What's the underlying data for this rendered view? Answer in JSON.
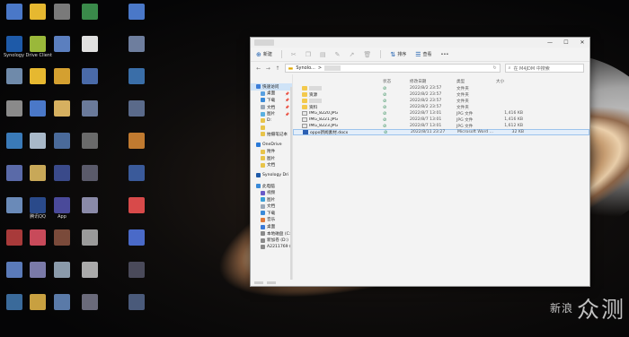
{
  "desktop": {
    "icons": [
      {
        "label": "",
        "color": "#4a78c8"
      },
      {
        "label": "",
        "color": "#e6b830"
      },
      {
        "label": "",
        "color": "#7a7a7a"
      },
      {
        "label": "",
        "color": "#3a8a4a"
      },
      {
        "label": "",
        "color": "#4a78c8"
      },
      {
        "label": "Synology Drive Client",
        "color": "#1e5aa8"
      },
      {
        "label": "",
        "color": "#9ab83a"
      },
      {
        "label": "",
        "color": "#5b7fbf"
      },
      {
        "label": "",
        "color": "#e0e0e0"
      },
      {
        "label": "",
        "color": "#6e7e9e"
      },
      {
        "label": "",
        "color": "#6f8aaa"
      },
      {
        "label": "",
        "color": "#e6b830"
      },
      {
        "label": "",
        "color": "#d4a030"
      },
      {
        "label": "",
        "color": "#4a6aa8"
      },
      {
        "label": "",
        "color": "#3a6ea8"
      },
      {
        "label": "",
        "color": "#8a8a8a"
      },
      {
        "label": "",
        "color": "#4a78c8"
      },
      {
        "label": "",
        "color": "#d6b060"
      },
      {
        "label": "",
        "color": "#6a7a9a"
      },
      {
        "label": "",
        "color": "#5a6a8a"
      },
      {
        "label": "",
        "color": "#3a7ab8"
      },
      {
        "label": "",
        "color": "#a8b8c8"
      },
      {
        "label": "",
        "color": "#4a6a9a"
      },
      {
        "label": "",
        "color": "#6a6a6a"
      },
      {
        "label": "",
        "color": "#c07a30"
      },
      {
        "label": "",
        "color": "#5a6aa8"
      },
      {
        "label": "",
        "color": "#c8a858"
      },
      {
        "label": "",
        "color": "#3a4a8a"
      },
      {
        "label": "",
        "color": "#5a5a6a"
      },
      {
        "label": "",
        "color": "#3a5a9a"
      },
      {
        "label": "",
        "color": "#6a8ab8"
      },
      {
        "label": "腾讯QQ",
        "color": "#2a4a8a"
      },
      {
        "label": "App",
        "color": "#4a4a9a"
      },
      {
        "label": "",
        "color": "#8a8aa8"
      },
      {
        "label": "",
        "color": "#d84a4a"
      },
      {
        "label": "",
        "color": "#a83a3a"
      },
      {
        "label": "",
        "color": "#c84a5a"
      },
      {
        "label": "",
        "color": "#7a4a3a"
      },
      {
        "label": "",
        "color": "#9a9a9a"
      },
      {
        "label": "",
        "color": "#4a6ac8"
      },
      {
        "label": "",
        "color": "#5a7ab8"
      },
      {
        "label": "",
        "color": "#7a7aa8"
      },
      {
        "label": "",
        "color": "#8a9aaa"
      },
      {
        "label": "",
        "color": "#aaaaaa"
      },
      {
        "label": "",
        "color": "#4a4a5a"
      },
      {
        "label": "",
        "color": "#3a6a9a"
      },
      {
        "label": "",
        "color": "#c8a040"
      },
      {
        "label": "",
        "color": "#5a7aa8"
      },
      {
        "label": "",
        "color": "#6a6a7a"
      },
      {
        "label": "",
        "color": "#4a5a7a"
      }
    ]
  },
  "window": {
    "toolbar": {
      "new_label": "新建",
      "sort_label": "排序",
      "view_label": "查看",
      "more_label": "•••"
    },
    "address": {
      "path_root": "Synolo...",
      "path_sep": ">",
      "search_placeholder": "在 M4JDM 中搜索"
    },
    "sidebar": {
      "quick_access": "快速访问",
      "items_pinned": [
        "桌面",
        "下载",
        "文档",
        "图片"
      ],
      "items_unpinned": [
        "D:",
        "",
        "拍摄笔记本"
      ],
      "onedrive": "OneDrive",
      "onedrive_items": [
        "附件",
        "图片",
        "文档"
      ],
      "synology": "Synology Dri",
      "this_pc": "此电脑",
      "pc_items": [
        "视频",
        "图片",
        "文档",
        "下载",
        "音乐",
        "桌面",
        "本地磁盘 (C:",
        "新加卷 (D:)",
        "A2211769 ("
      ]
    },
    "columns": {
      "status": "状态",
      "date": "修改日期",
      "type": "类型",
      "size": "大小"
    },
    "files": [
      {
        "name": "",
        "kind": "folder",
        "date": "2022/8/2 23:57",
        "type": "文件夹",
        "size": ""
      },
      {
        "name": "资源",
        "kind": "folder",
        "date": "2022/8/2 23:57",
        "type": "文件夹",
        "size": ""
      },
      {
        "name": "",
        "kind": "folder",
        "date": "2022/8/2 23:57",
        "type": "文件夹",
        "size": ""
      },
      {
        "name": "资料",
        "kind": "folder",
        "date": "2022/8/2 23:57",
        "type": "文件夹",
        "size": ""
      },
      {
        "name": "IMG_8220.JPG",
        "kind": "jpg",
        "date": "2022/8/7 13:01",
        "type": "JPG 文件",
        "size": "1,416 KB"
      },
      {
        "name": "IMG_8221.JPG",
        "kind": "jpg",
        "date": "2022/8/7 13:01",
        "type": "JPG 文件",
        "size": "1,416 KB"
      },
      {
        "name": "IMG_8223.JPG",
        "kind": "jpg",
        "date": "2022/8/7 13:01",
        "type": "JPG 文件",
        "size": "1,612 KB"
      },
      {
        "name": "oppo新闻素材.docx",
        "kind": "docx",
        "date": "2022/8/11 23:27",
        "type": "Microsoft Word ...",
        "size": "32 KB"
      }
    ]
  },
  "watermark": {
    "small": "新浪",
    "big": "众测"
  }
}
